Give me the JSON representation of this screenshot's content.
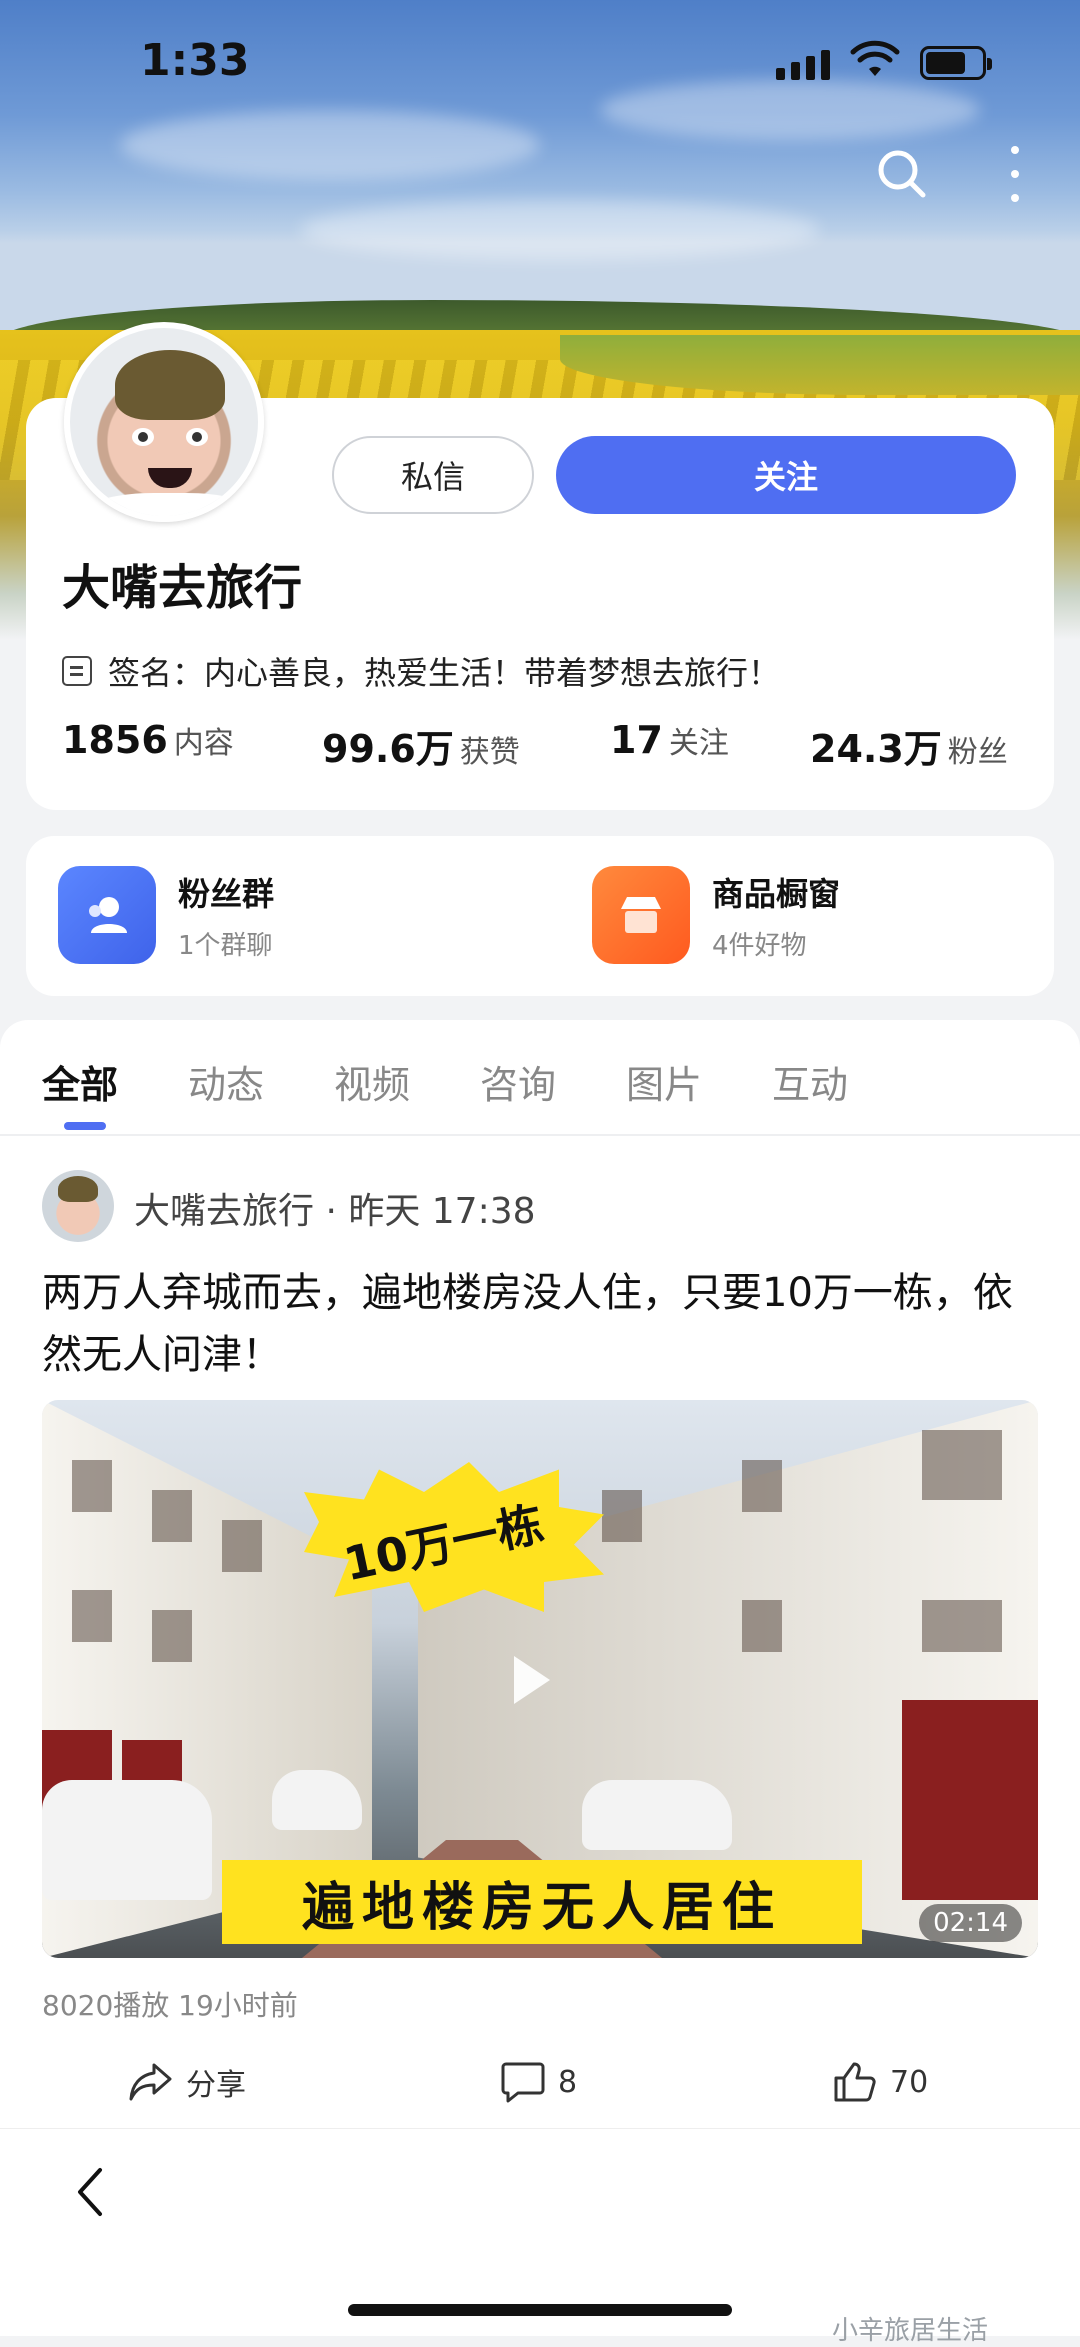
{
  "status_bar": {
    "time": "1:33"
  },
  "header": {
    "search_icon": "search-icon",
    "more_icon": "more-icon"
  },
  "profile": {
    "name": "大嘴去旅行",
    "message_button": "私信",
    "follow_button": "关注",
    "signature": "签名：内心善良，热爱生活！带着梦想去旅行！",
    "stats": [
      {
        "value": "1856",
        "label": "内容"
      },
      {
        "value": "99.6万",
        "label": "获赞"
      },
      {
        "value": "17",
        "label": "关注"
      },
      {
        "value": "24.3万",
        "label": "粉丝"
      }
    ]
  },
  "shortcuts": [
    {
      "title": "粉丝群",
      "subtitle": "1个群聊",
      "icon": "fans-group-icon",
      "color": "#4f6ef2"
    },
    {
      "title": "商品橱窗",
      "subtitle": "4件好物",
      "icon": "shop-icon",
      "color": "#ff6a2a"
    }
  ],
  "tabs": [
    "全部",
    "动态",
    "视频",
    "咨询",
    "图片",
    "互动"
  ],
  "active_tab": "全部",
  "post": {
    "author_line": "大嘴去旅行 · 昨天 17:38",
    "title": "两万人弃城而去，遍地楼房没人住，只要10万一栋，依然无人问津！",
    "video": {
      "badge_text": "10万一栋",
      "caption_text": "遍地楼房无人居住",
      "duration": "02:14"
    },
    "meta": "8020播放  19小时前",
    "actions": {
      "share": "分享",
      "comments": "8",
      "likes": "70"
    }
  },
  "watermark": "小辛旅居生活",
  "colors": {
    "accent": "#4f6ef2",
    "orange": "#ff6a2a",
    "yellow": "#ffe21f"
  }
}
